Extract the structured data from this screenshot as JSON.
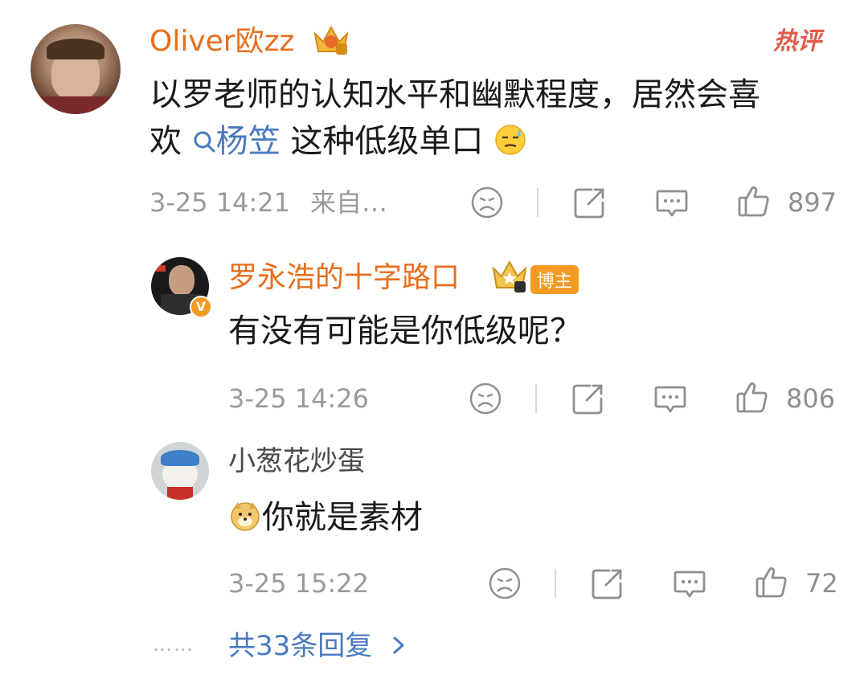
{
  "comment1": {
    "author": "Oliver欧zz",
    "hot_tag": "热评",
    "text_line1": "以罗老师的认知水平和幽默程度，居然会喜",
    "text_pre": "欢",
    "mention": "杨笠",
    "text_post": "这种低级单口",
    "time": "3-25 14:21",
    "source": "来自…",
    "likes": "897"
  },
  "reply1": {
    "author": "罗永浩的十字路口",
    "role_badge": "博主",
    "text": "有没有可能是你低级呢？",
    "time": "3-25 14:26",
    "likes": "806"
  },
  "reply2": {
    "author": "小葱花炒蛋",
    "text": "你就是素材",
    "time": "3-25 15:22",
    "likes": "72"
  },
  "more": {
    "dots": "……",
    "label": "共33条回复"
  },
  "colors": {
    "author_orange": "#e86e1c",
    "link_blue": "#4a79c0",
    "meta_gray": "#9a9a9a",
    "badge_orange": "#f29a22"
  },
  "icons": [
    "sad-face-icon",
    "share-icon",
    "comment-icon",
    "like-icon",
    "crown-icon",
    "search-icon",
    "emoji-icon",
    "chevron-right-icon",
    "verified-icon"
  ]
}
